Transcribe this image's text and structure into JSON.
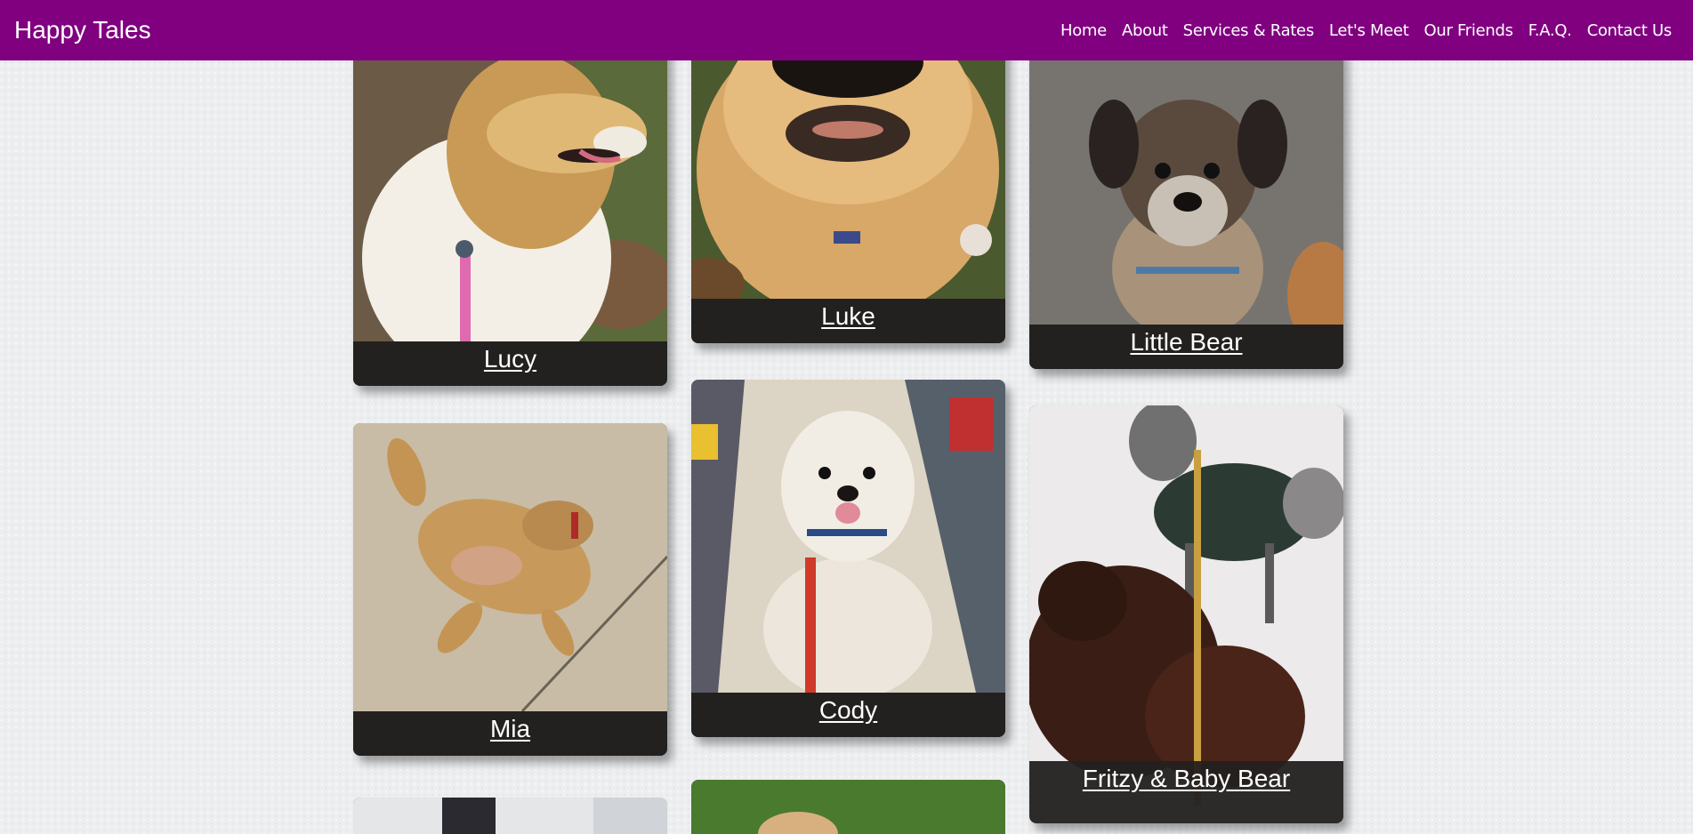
{
  "header": {
    "brand": "Happy Tales",
    "nav": [
      "Home",
      "About",
      "Services & Rates",
      "Let's Meet",
      "Our Friends",
      "F.A.Q.",
      "Contact Us"
    ]
  },
  "gallery": {
    "cards": [
      {
        "name": "Lucy"
      },
      {
        "name": "Luke"
      },
      {
        "name": "Little Bear"
      },
      {
        "name": "Mia"
      },
      {
        "name": "Cody"
      },
      {
        "name": "Fritzy & Baby Bear"
      },
      {
        "name": ""
      },
      {
        "name": ""
      }
    ]
  },
  "colors": {
    "nav_bg": "#800080",
    "caption_bg": "#23211f",
    "page_bg": "#eceef0"
  }
}
